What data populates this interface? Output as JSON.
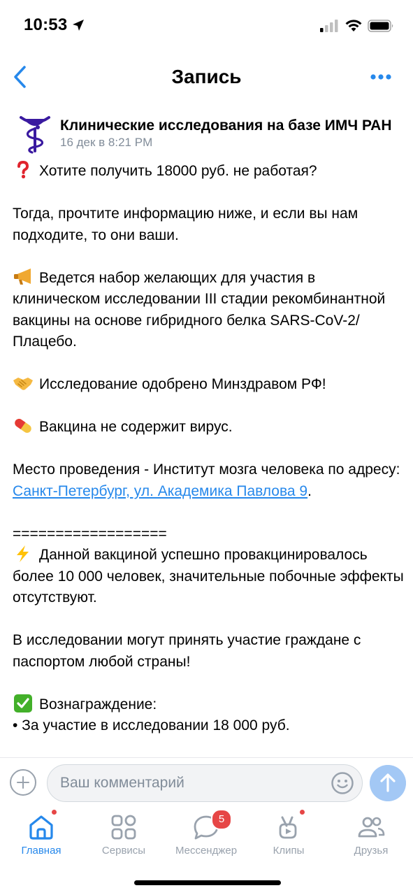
{
  "status_bar": {
    "time": "10:53",
    "icons": [
      "location-arrow-icon",
      "cellular-signal-icon",
      "wifi-icon",
      "battery-icon"
    ]
  },
  "nav": {
    "title": "Запись",
    "back_icon": "chevron-left-icon",
    "more_icon": "more-horizontal-icon"
  },
  "post": {
    "author": "Клинические исследования на базе ИМЧ РАН",
    "date": "16 дек в 8:21 PM",
    "lines": {
      "question": "Хотите получить 18000 руб. не работая?",
      "then": "Тогда, прочтите информацию ниже, и если вы нам подходите, то они ваши.",
      "recruitment": "Ведется набор желающих для участия в клиническом исследовании III стадии рекомбинантной вакцины на основе гибридного белка SARS-CoV-2/Плацебо.",
      "approved": "Исследование одобрено Минздравом РФ!",
      "no_virus": "Вакцина не содержит вирус.",
      "location_prefix": "Место проведения - Институт мозга человека по адресу: ",
      "location_link": "Санкт-Петербург, ул. Академика Павлова 9",
      "location_suffix": ".",
      "divider": "==================",
      "vaccinated": "Данной вакциной успешно провакцинировалось более 10 000 человек, значительные побочные эффекты отсутствуют.",
      "citizens": "В исследовании могут принять участие граждане с паспортом любой страны!",
      "reward_title": "Вознаграждение:",
      "reward_item": "• За участие в исследовании 18 000 руб."
    },
    "emoji_icons": [
      "red-question-mark-icon",
      "megaphone-icon",
      "handshake-icon",
      "pill-icon",
      "lightning-icon",
      "green-check-icon"
    ]
  },
  "comment": {
    "placeholder": "Ваш комментарий",
    "value": ""
  },
  "tabs": [
    {
      "label": "Главная",
      "icon": "home-icon",
      "active": true,
      "dot": true
    },
    {
      "label": "Сервисы",
      "icon": "services-grid-icon",
      "active": false,
      "dot": false
    },
    {
      "label": "Мессенджер",
      "icon": "chat-bubble-icon",
      "active": false,
      "badge": "5"
    },
    {
      "label": "Клипы",
      "icon": "clips-icon",
      "active": false,
      "dot": true
    },
    {
      "label": "Друзья",
      "icon": "friends-icon",
      "active": false,
      "dot": false
    }
  ],
  "colors": {
    "accent": "#2688eb",
    "secondary_text": "#818c99",
    "inactive_icon": "#99a2ad",
    "badge": "#e64646",
    "send_button": "#a3c8f5",
    "avatar": "#3a1aa0"
  }
}
